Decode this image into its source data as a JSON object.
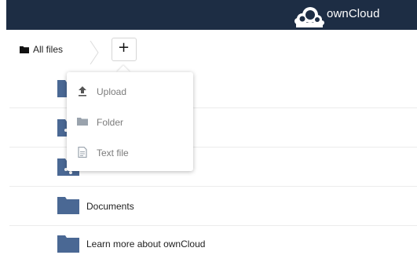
{
  "header": {
    "brand": "ownCloud",
    "color": "#1d2d44",
    "logo_icon": "owncloud-cloud-icon"
  },
  "breadcrumb": {
    "home_label": "All files",
    "home_icon": "folder-icon",
    "new_button_label": "+"
  },
  "new_menu": {
    "items": [
      {
        "label": "Upload",
        "icon": "upload-icon"
      },
      {
        "label": "Folder",
        "icon": "folder-icon"
      },
      {
        "label": "Text file",
        "icon": "text-file-icon"
      }
    ]
  },
  "files": [
    {
      "name": "",
      "icon": "shared-folder-icon"
    },
    {
      "name": "",
      "icon": "shared-folder-icon"
    },
    {
      "name": "Documents",
      "icon": "folder-icon"
    },
    {
      "name": "Learn more about ownCloud",
      "icon": "folder-icon"
    }
  ],
  "colors": {
    "folder": "#4a6894",
    "menu_text": "#7b7b7b"
  }
}
